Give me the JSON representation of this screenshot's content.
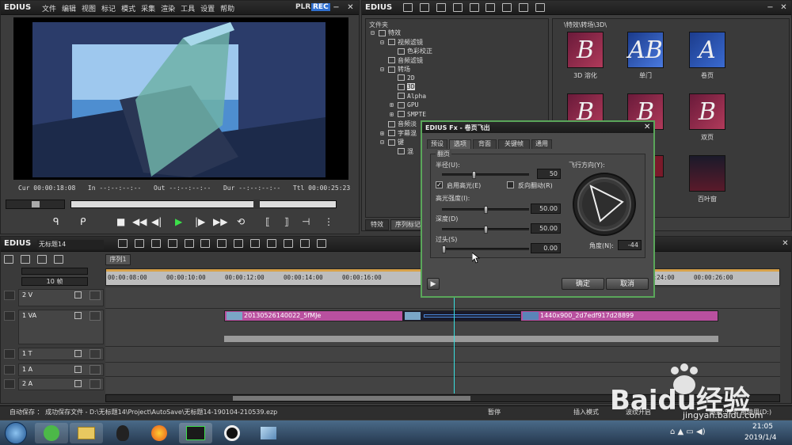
{
  "player": {
    "logo": "EDIUS",
    "menu": [
      "文件",
      "编辑",
      "视图",
      "标记",
      "模式",
      "采集",
      "渲染",
      "工具",
      "设置",
      "帮助"
    ],
    "plr": "PLR",
    "rec": "REC",
    "timecodes": {
      "cur_label": "Cur",
      "cur": "00:00:18:08",
      "in_label": "In",
      "in": "--:--:--:--",
      "out_label": "Out",
      "out": "--:--:--:--",
      "dur_label": "Dur",
      "dur": "--:--:--:--",
      "ttl_label": "Ttl",
      "ttl": "00:00:25:23"
    }
  },
  "effects_panel": {
    "logo": "EDIUS",
    "tree_header": "文件夹",
    "tree": [
      {
        "label": "特效",
        "depth": 0,
        "exp": "⊟"
      },
      {
        "label": "视频滤镜",
        "depth": 1,
        "exp": "⊟"
      },
      {
        "label": "色彩校正",
        "depth": 2,
        "exp": ""
      },
      {
        "label": "音频滤镜",
        "depth": 1,
        "exp": ""
      },
      {
        "label": "转场",
        "depth": 1,
        "exp": "⊟"
      },
      {
        "label": "2D",
        "depth": 2,
        "exp": ""
      },
      {
        "label": "3D",
        "depth": 2,
        "exp": "",
        "selected": true
      },
      {
        "label": "Alpha",
        "depth": 2,
        "exp": ""
      },
      {
        "label": "GPU",
        "depth": 2,
        "exp": "⊞"
      },
      {
        "label": "SMPTE",
        "depth": 2,
        "exp": "⊞"
      },
      {
        "label": "音频淡",
        "depth": 1,
        "exp": ""
      },
      {
        "label": "字幕混",
        "depth": 1,
        "exp": "⊞"
      },
      {
        "label": "键",
        "depth": 1,
        "exp": "⊟"
      },
      {
        "label": "混",
        "depth": 2,
        "exp": ""
      }
    ],
    "path": "\\特效\\转场\\3D\\",
    "thumbs": [
      {
        "label": "3D 溶化",
        "letter": "B"
      },
      {
        "label": "单门",
        "letter": "AB"
      },
      {
        "label": "卷页",
        "letter": "A"
      },
      {
        "label": "",
        "letter": "B"
      },
      {
        "label": "",
        "letter": "B"
      },
      {
        "label": "双页",
        "letter": "B"
      },
      {
        "label": "",
        "letter": ""
      },
      {
        "label": "",
        "letter": ""
      },
      {
        "label": "百叶窗",
        "letter": ""
      }
    ],
    "tabs": [
      "特效",
      "序列标记"
    ]
  },
  "dialog": {
    "title": "EDIUS Fx - 卷页飞出",
    "tabs": [
      "预设",
      "选项",
      "背面",
      "关键帧",
      "通用"
    ],
    "active_tab": 1,
    "group": "翻页",
    "radius_label": "半径(U):",
    "radius": "50",
    "radius_frac": 0.36,
    "highlight_label": "启用高光(E)",
    "highlight_checked": true,
    "reverse_label": "反向翻动(R)",
    "reverse_checked": false,
    "direction_label": "飞行方向(Y):",
    "intensity_label": "高光强度(I):",
    "intensity": "50.00",
    "intensity_frac": 0.5,
    "depth_label": "深度(D)",
    "depth": "50.00",
    "depth_frac": 0.5,
    "overshoot_label": "过头(S)",
    "overshoot": "0.00",
    "overshoot_frac": 0.0,
    "angle_label": "角度(N):",
    "angle": "-44",
    "ok": "确定",
    "cancel": "取消",
    "play": "▶"
  },
  "timeline": {
    "logo": "EDIUS",
    "project": "无标题14",
    "sequence_tab": "序列1",
    "zoom": "10 帧",
    "ruler": [
      "00:00:08:00",
      "00:00:10:00",
      "00:00:12:00",
      "00:00:14:00",
      "00:00:16:00",
      "00:00:24:00",
      "00:00:26:00"
    ],
    "tracks": [
      {
        "label": "2 V"
      },
      {
        "label": "1 VA"
      },
      {
        "label": "1 T"
      },
      {
        "label": "1 A"
      },
      {
        "label": "2 A"
      }
    ],
    "clip1": "20130526140022_5fMJe",
    "clip2": "1440x900_2d7edf917d28899"
  },
  "status": {
    "autosave": "自动保存 ： 成功保存文件 - D:\\无标题14\\Project\\AutoSave\\无标题14-190104-210539.ezp",
    "pause": "暂停",
    "insert_mode": "插入模式",
    "ripple": "波纹开启",
    "disk": "磁盘:52% 被使用(D:)"
  },
  "taskbar": {
    "time": "21:05",
    "date": "2019/1/4"
  },
  "watermark": {
    "brand": "Baidu经验",
    "url": "jingyan.baidu.com"
  }
}
